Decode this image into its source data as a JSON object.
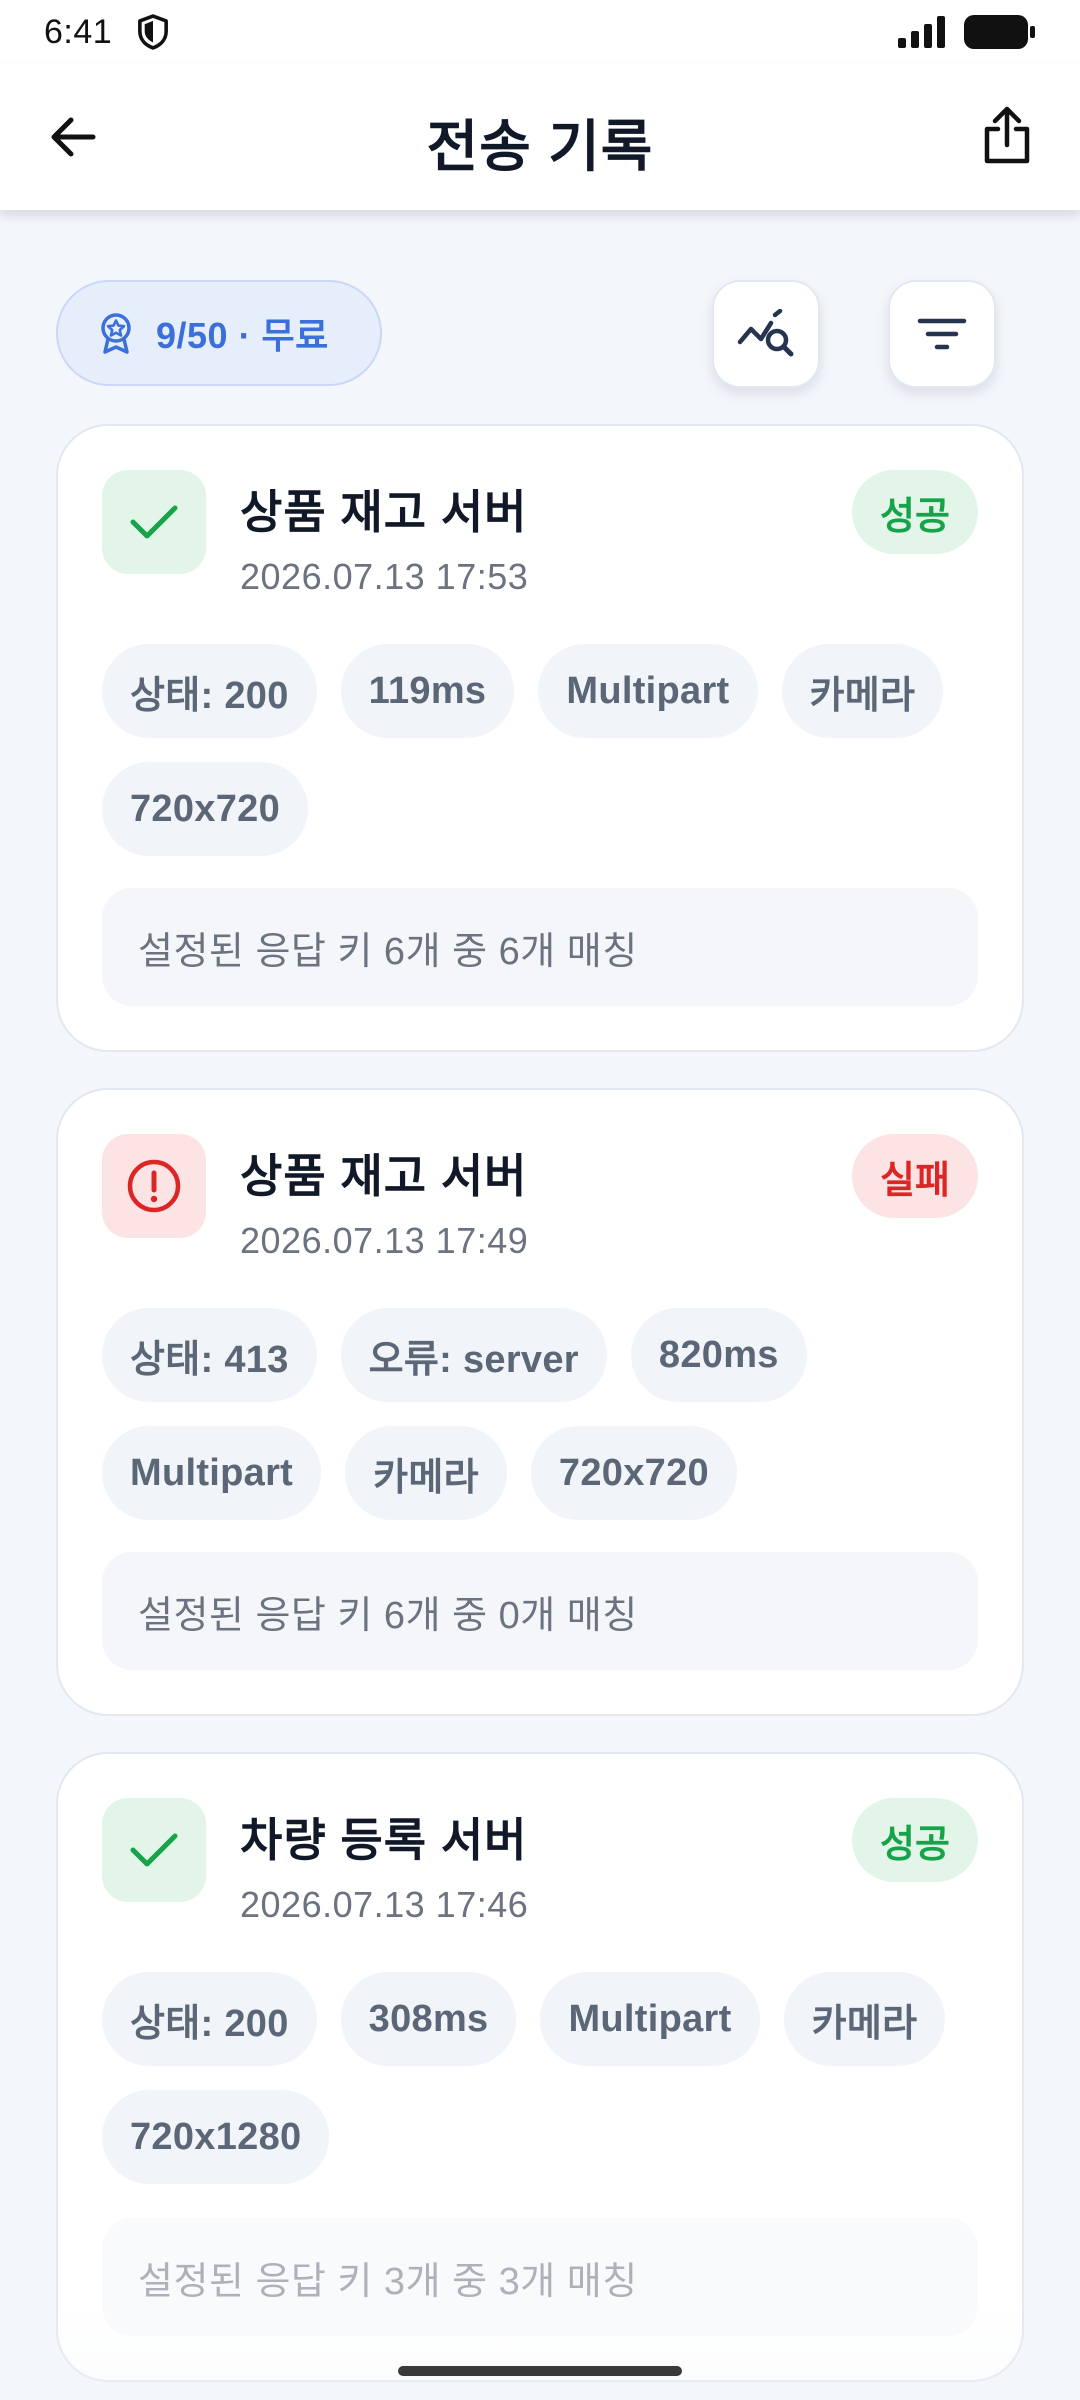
{
  "status_bar": {
    "time": "6:41",
    "icons": [
      "shield-icon",
      "signal-icon",
      "battery-icon"
    ]
  },
  "app_bar": {
    "title": "전송 기록",
    "back_icon": "arrow-left-icon",
    "share_icon": "share-icon"
  },
  "toolbar": {
    "plan_label": "9/50 · 무료",
    "plan_icon": "award-badge-icon",
    "analytics_icon": "chart-search-icon",
    "filter_icon": "filter-icon"
  },
  "colors": {
    "accent": "#3B6FD9",
    "success": "#16A34A",
    "error": "#DC2626",
    "background": "#F3F6FB"
  },
  "records": [
    {
      "title": "상품 재고 서버",
      "time": "2026.07.13 17:53",
      "result": "성공",
      "result_type": "success",
      "chips": [
        "상태: 200",
        "119ms",
        "Multipart",
        "카메라",
        "720x720"
      ],
      "match_text": "설정된 응답 키 6개 중 6개 매칭"
    },
    {
      "title": "상품 재고 서버",
      "time": "2026.07.13 17:49",
      "result": "실패",
      "result_type": "error",
      "chips": [
        "상태: 413",
        "오류: server",
        "820ms",
        "Multipart",
        "카메라",
        "720x720"
      ],
      "match_text": "설정된 응답 키 6개 중 0개 매칭"
    },
    {
      "title": "차량 등록 서버",
      "time": "2026.07.13 17:46",
      "result": "성공",
      "result_type": "success",
      "chips": [
        "상태: 200",
        "308ms",
        "Multipart",
        "카메라",
        "720x1280"
      ],
      "match_text": "설정된 응답 키 3개 중 3개 매칭"
    }
  ]
}
